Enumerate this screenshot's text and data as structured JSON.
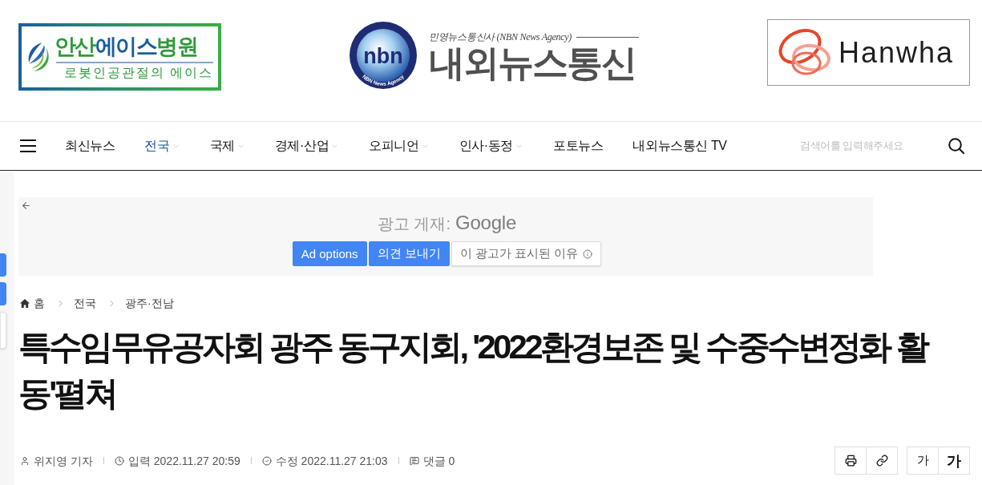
{
  "header": {
    "hospital_ad": {
      "title_parts": [
        {
          "text": "안산",
          "color": "#2f9a3c"
        },
        {
          "text": "에이스",
          "color": "#1c5c9c"
        },
        {
          "text": "병원",
          "color": "#2f9a3c"
        }
      ],
      "tagline": "로봇인공관절의 에이스"
    },
    "site_logo": {
      "emblem_text": "nbn",
      "emblem_caption": "NBN News Agency",
      "tagline": "민영뉴스통신사 (NBN News Agency)",
      "name": "내외뉴스통신"
    },
    "sponsor_ad": {
      "name": "Hanwha"
    }
  },
  "nav": {
    "items": [
      {
        "label": "최신뉴스",
        "selected": false,
        "has_submenu": false
      },
      {
        "label": "전국",
        "selected": true,
        "has_submenu": true
      },
      {
        "label": "국제",
        "selected": false,
        "has_submenu": true
      },
      {
        "label": "경제·산업",
        "selected": false,
        "has_submenu": true
      },
      {
        "label": "오피니언",
        "selected": false,
        "has_submenu": true
      },
      {
        "label": "인사·동정",
        "selected": false,
        "has_submenu": true
      },
      {
        "label": "포토뉴스",
        "selected": false,
        "has_submenu": false
      },
      {
        "label": "내외뉴스통신 TV",
        "selected": false,
        "has_submenu": false
      }
    ],
    "search": {
      "placeholder": "검색어를 입력해주세요"
    }
  },
  "side_tabs": [
    {
      "kind": "filled"
    },
    {
      "kind": "filled"
    },
    {
      "kind": "outlined"
    }
  ],
  "ad_notice": {
    "label": "광고 게재:",
    "brand": "Google",
    "buttons": [
      {
        "label": "Ad options",
        "kind": "primary"
      },
      {
        "label": "의견 보내기",
        "kind": "primary"
      },
      {
        "label": "이 광고가 표시된 이유",
        "kind": "info"
      }
    ]
  },
  "breadcrumb": [
    "홈",
    "전국",
    "광주·전남"
  ],
  "article": {
    "title": "특수임무유공자회 광주 동구지회, '2022환경보존 및 수중수변정화 활동'펼쳐",
    "meta": [
      {
        "kind": "author",
        "text": "위지영 기자"
      },
      {
        "kind": "created",
        "text": "입력 2022.11.27 20:59"
      },
      {
        "kind": "modified",
        "text": "수정 2022.11.27 21:03"
      },
      {
        "kind": "comments",
        "text": "댓글 0"
      }
    ],
    "tools": [
      {
        "kind": "print"
      },
      {
        "kind": "link"
      }
    ],
    "font_size_buttons": [
      {
        "label": "가",
        "kind": "smaller"
      },
      {
        "label": "가",
        "kind": "larger"
      }
    ]
  }
}
